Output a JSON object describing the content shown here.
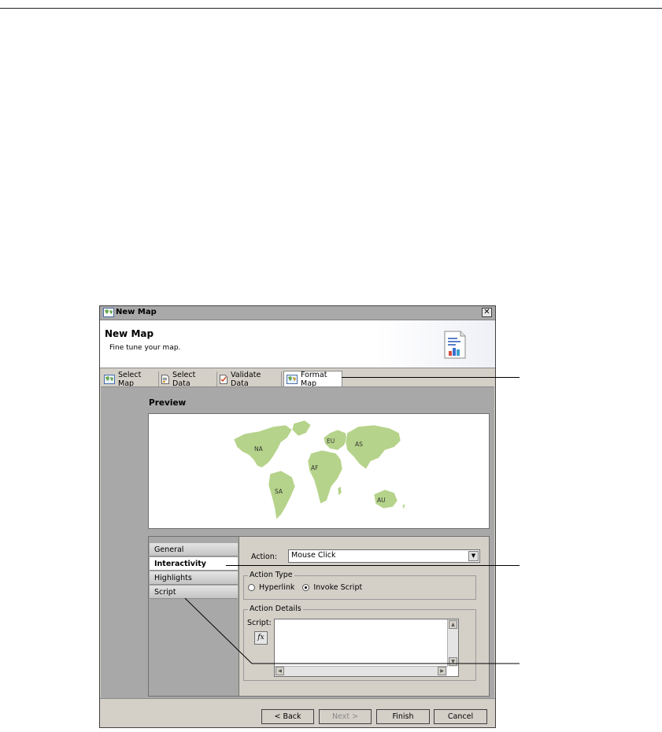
{
  "dialog": {
    "window_title": "New Map",
    "header_title": "New Map",
    "header_subtitle": "Fine tune your map."
  },
  "tabs": [
    {
      "label": "Select Map",
      "icon": "map-icon",
      "active": false
    },
    {
      "label": "Select Data",
      "icon": "data-icon",
      "active": false
    },
    {
      "label": "Validate Data",
      "icon": "validate-icon",
      "active": false
    },
    {
      "label": "Format Map",
      "icon": "format-map-icon",
      "active": true
    }
  ],
  "preview": {
    "label": "Preview",
    "regions": [
      "NA",
      "EU",
      "AS",
      "AF",
      "SA",
      "AU"
    ],
    "map_color": "#b5d38a"
  },
  "nav": [
    {
      "label": "General",
      "active": false
    },
    {
      "label": "Interactivity",
      "active": true
    },
    {
      "label": "Highlights",
      "active": false
    },
    {
      "label": "Script",
      "active": false
    }
  ],
  "interactivity": {
    "action_label": "Action:",
    "action_value": "Mouse Click",
    "action_type_legend": "Action Type",
    "hyperlink_label": "Hyperlink",
    "invoke_script_label": "Invoke Script",
    "selected_action_type": "Invoke Script",
    "action_details_legend": "Action Details",
    "script_label": "Script:",
    "fx_label": "fx"
  },
  "buttons": {
    "back": "< Back",
    "next": "Next >",
    "finish": "Finish",
    "cancel": "Cancel"
  }
}
